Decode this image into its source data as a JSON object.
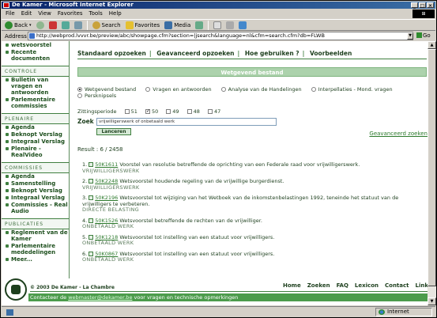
{
  "window": {
    "title": "De Kamer - Microsoft Internet Explorer"
  },
  "menu": [
    "File",
    "Edit",
    "View",
    "Favorites",
    "Tools",
    "Help"
  ],
  "toolbar": {
    "back": "Back",
    "search": "Search",
    "favorites": "Favorites",
    "media": "Media"
  },
  "address": {
    "label": "Address",
    "url": "http://webprod.lvvvr.be/preview/abc/showpage.cfm?section=|jsearch&language=nl&cfm=search.cfm?db=FLWB",
    "go": "Go"
  },
  "sidebar": {
    "top_items": [
      "wetsvoorstel",
      "Recente documenten"
    ],
    "sections": [
      {
        "head": "CONTROLE",
        "items": [
          "Bulletin van vragen en antwoorden",
          "Parlementaire commissies"
        ]
      },
      {
        "head": "PLENAIRE",
        "items": [
          "Agenda",
          "Beknopt Verslag",
          "Integraal Verslag",
          "Plenaire - RealVideo"
        ]
      },
      {
        "head": "COMMISSIES",
        "items": [
          "Agenda",
          "Samenstelling",
          "Beknopt Verslag",
          "Integraal Verslag",
          "Commissies - Real Audio"
        ]
      },
      {
        "head": "PUBLICATIES",
        "items": [
          "Reglement van de Kamer",
          "Parlementaire mededelingen",
          "Meer..."
        ]
      }
    ]
  },
  "nav": {
    "items": [
      "Standaard opzoeken",
      "Geavanceerd opzoeken",
      "Hoe gebruiken ?",
      "Voorbeelden"
    ]
  },
  "banner": "Wetgevend bestand",
  "types": {
    "options": [
      "Wetgevend bestand",
      "Vragen en antwoorden",
      "Analyse van de Handelingen",
      "Interpellaties - Mond. vragen",
      "Persknipsels"
    ],
    "selected": 0
  },
  "period": {
    "label": "Zittingsperiode",
    "options": [
      "51",
      "50",
      "49",
      "48",
      "47"
    ],
    "checked": [
      false,
      true,
      false,
      false,
      false
    ]
  },
  "search": {
    "label": "Zoek :",
    "value": "vrijwilligerswerk of onbetaald werk",
    "button": "Lanceren",
    "advanced": "Geavanceerd zoeken"
  },
  "result": "Result : 6 / 2458",
  "results": [
    {
      "n": "1.",
      "ref": "50K1611",
      "text": "Voorstel van resolutie betreffende de oprichting van een Federale raad voor vrijwilligerswerk.",
      "status": "VRIJWILLIGERSWERK"
    },
    {
      "n": "2.",
      "ref": "50K2248",
      "text": "Wetsvoorstel houdende regeling van de vrijwillige burgerdienst.",
      "status": "VRIJWILLIGERSWERK"
    },
    {
      "n": "3.",
      "ref": "50K2196",
      "text": "Wetsvoorstel tot wijziging van het Wetboek van de inkomstenbelastingen 1992, teneinde het statuut van de vrijwilligers te verbeteren.",
      "status": "DIRECTE BELASTING"
    },
    {
      "n": "4.",
      "ref": "50K1526",
      "text": "Wetsvoorstel betreffende de rechten van de vrijwilliger.",
      "status": "ONBETAALD WERK"
    },
    {
      "n": "5.",
      "ref": "50K1218",
      "text": "Wetsvoorstel tot instelling van een statuut voor vrijwilligers.",
      "status": "ONBETAALD WERK"
    },
    {
      "n": "6.",
      "ref": "50K0867",
      "text": "Wetsvoorstel tot instelling van een statuut voor vrijwilligers.",
      "status": "ONBETAALD WERK"
    }
  ],
  "footer": {
    "copyright": "© 2003 De Kamer - La Chambre",
    "links": [
      "Home",
      "Zoeken",
      "FAQ",
      "Lexicon",
      "Contact",
      "Links"
    ],
    "contact_prefix": "Contacteer de ",
    "contact_email": "webmaster@dekamer.be",
    "contact_suffix": " voor vragen en technische opmerkingen"
  },
  "status": {
    "zone": "Internet"
  },
  "colors": {
    "brand_green": "#3f7f3f",
    "banner": "#acd2ac",
    "titlebar": "#0a246a"
  }
}
